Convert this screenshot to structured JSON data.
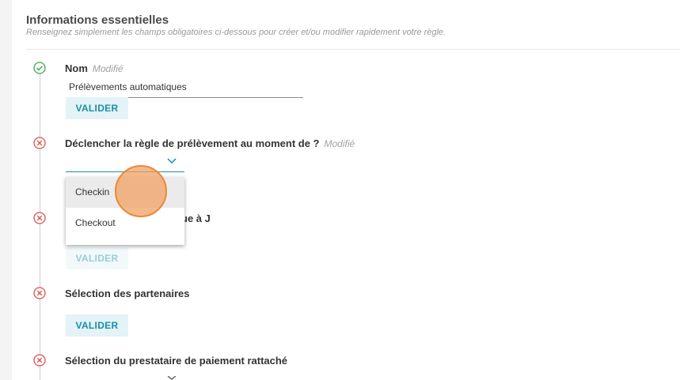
{
  "header": {
    "title": "Informations essentielles",
    "subtitle": "Renseignez simplement les champs obligatoires ci-dessous pour créer et/ou modifier rapidement votre règle."
  },
  "steps": [
    {
      "label": "Nom",
      "modified": "Modifié",
      "status": "valid",
      "icon": "check-circle-icon"
    },
    {
      "label": "Déclencher la règle de prélèvement au moment de ?",
      "modified": "Modifié",
      "status": "invalid",
      "icon": "x-circle-icon"
    },
    {
      "label_visible_fragment": "ue à J",
      "status": "invalid",
      "icon": "x-circle-icon"
    },
    {
      "label": "Sélection des partenaires",
      "status": "invalid",
      "icon": "x-circle-icon"
    },
    {
      "label": "Sélection du prestataire de paiement rattaché",
      "status": "invalid",
      "icon": "x-circle-icon"
    }
  ],
  "name_input": {
    "value": "Prélèvements automatiques"
  },
  "buttons": {
    "valider": "VALIDER"
  },
  "dropdown": {
    "options": [
      "Checkin",
      "Checkout"
    ],
    "highlighted": "Checkin"
  },
  "colors": {
    "accent": "#1a8fa6",
    "valid": "#3aa64a",
    "invalid": "#d9534f",
    "button_bg": "#e3f3f7"
  }
}
